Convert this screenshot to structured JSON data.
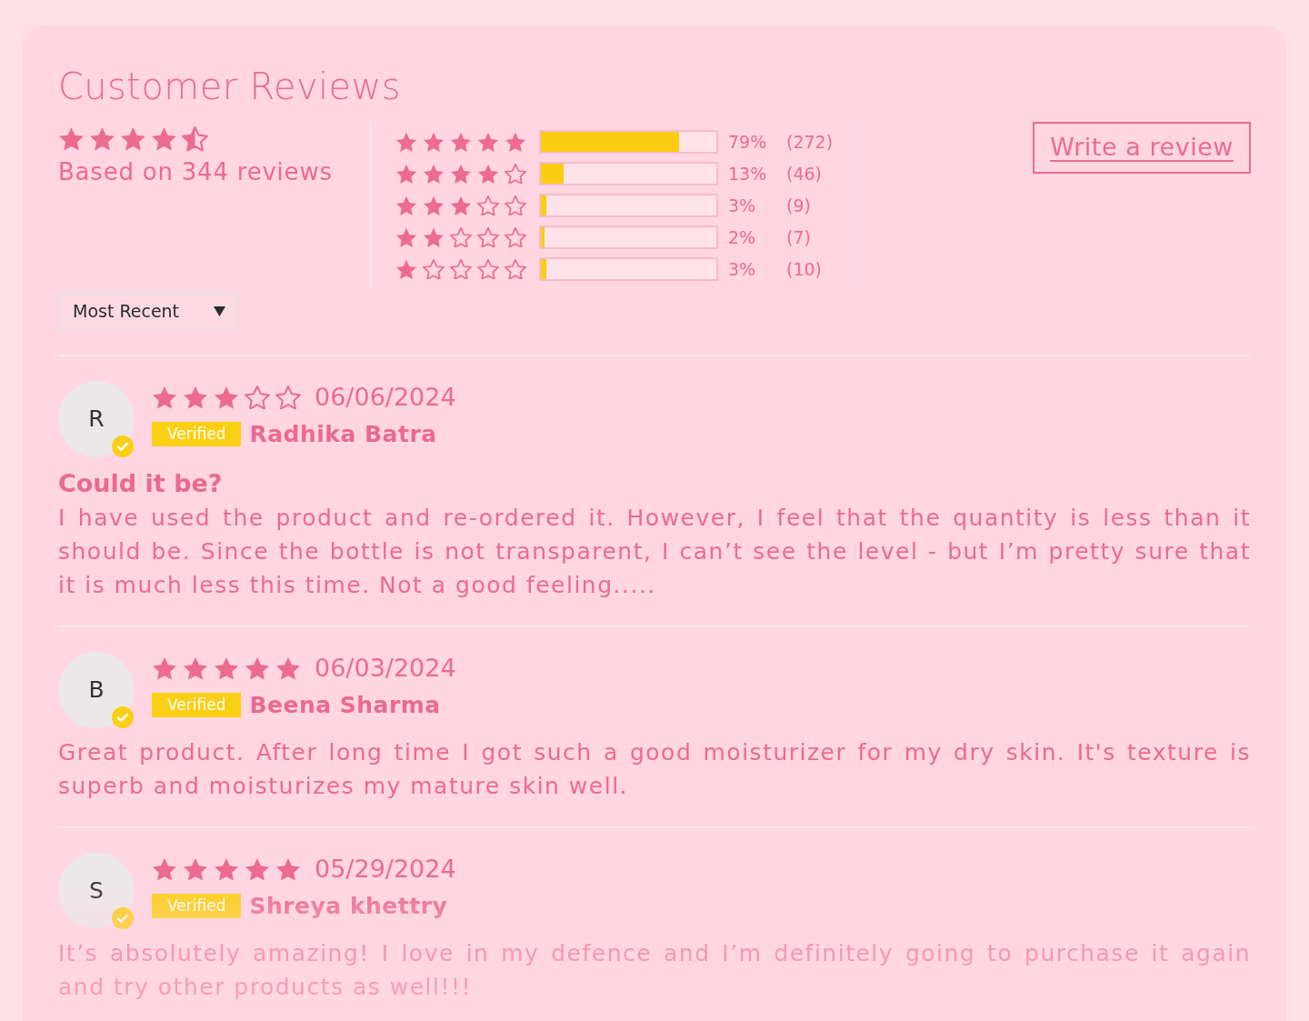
{
  "title": "Customer Reviews",
  "summary": {
    "stars": 4.5,
    "caption": "Based on 344 reviews"
  },
  "histogram": [
    {
      "stars": 5,
      "level": 0.79,
      "percent": "79%",
      "count": "(272)"
    },
    {
      "stars": 4,
      "level": 0.13,
      "percent": "13%",
      "count": "(46)"
    },
    {
      "stars": 3,
      "level": 0.03,
      "percent": "3%",
      "count": "(9)"
    },
    {
      "stars": 2,
      "level": 0.02,
      "percent": "2%",
      "count": "(7)"
    },
    {
      "stars": 1,
      "level": 0.03,
      "percent": "3%",
      "count": "(10)"
    }
  ],
  "write_review_button": {
    "label": "Write a review"
  },
  "sort_dropdown": {
    "value": "Most Recent"
  },
  "reviews": [
    {
      "avatar": "R",
      "verified": true,
      "stars": 3,
      "date": "06/06/2024",
      "badge": "Verified",
      "name": "Radhika Batra",
      "title": "Could it be?",
      "body": "I have used the product and re-ordered it. However, I feel that the quantity is less than it should be. Since the bottle is not transparent, I can’t see the level - but I’m pretty sure that it is much less this time. Not a good feeling....."
    },
    {
      "avatar": "B",
      "verified": true,
      "stars": 5,
      "date": "06/03/2024",
      "badge": "Verified",
      "name": "Beena Sharma",
      "body": "Great product. After long time I got such a good moisturizer for my dry skin. It's texture is superb and moisturizes my mature skin well."
    },
    {
      "avatar": "S",
      "verified": true,
      "stars": 5,
      "date": "05/29/2024",
      "badge": "Verified",
      "name": "Shreya khettry",
      "body": "It’s absolutely amazing! I love in my defence and I’m definitely going to purchase it again and try other products as well!!!"
    }
  ]
}
